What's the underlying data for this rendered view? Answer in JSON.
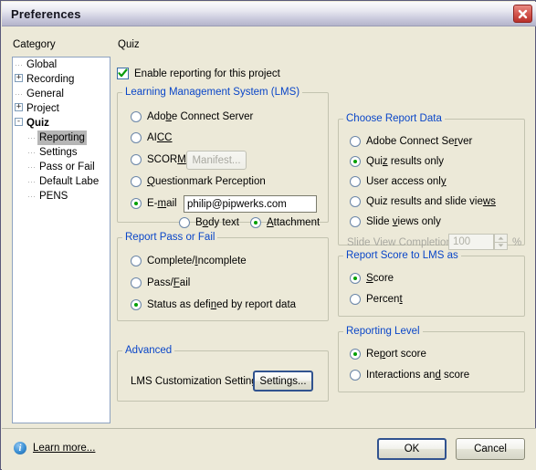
{
  "window": {
    "title": "Preferences",
    "close_icon": "close-icon"
  },
  "sidebar": {
    "header": "Category",
    "items": [
      {
        "label": "Global",
        "level": 1,
        "expander": "",
        "selected": false,
        "bold": false
      },
      {
        "label": "Recording",
        "level": 1,
        "expander": "+",
        "selected": false,
        "bold": false
      },
      {
        "label": "General",
        "level": 1,
        "expander": "",
        "selected": false,
        "bold": false
      },
      {
        "label": "Project",
        "level": 1,
        "expander": "+",
        "selected": false,
        "bold": false
      },
      {
        "label": "Quiz",
        "level": 1,
        "expander": "-",
        "selected": false,
        "bold": true
      },
      {
        "label": "Reporting",
        "level": 2,
        "expander": "",
        "selected": true,
        "bold": false
      },
      {
        "label": "Settings",
        "level": 2,
        "expander": "",
        "selected": false,
        "bold": false
      },
      {
        "label": "Pass or Fail",
        "level": 2,
        "expander": "",
        "selected": false,
        "bold": false
      },
      {
        "label": "Default Labe",
        "level": 2,
        "expander": "",
        "selected": false,
        "bold": false
      },
      {
        "label": "PENS",
        "level": 2,
        "expander": "",
        "selected": false,
        "bold": false
      }
    ]
  },
  "pane": {
    "header": "Quiz",
    "enable_reporting": {
      "label": "Enable reporting for this project",
      "checked": true
    },
    "lms": {
      "legend": "Learning Management System (LMS)",
      "options": [
        {
          "label": "Adobe Connect Server",
          "selected": false
        },
        {
          "label": "AICC",
          "selected": false
        },
        {
          "label": "SCORM",
          "selected": false
        },
        {
          "label": "Questionmark Perception",
          "selected": false
        },
        {
          "label": "E-mail",
          "selected": true
        }
      ],
      "manifest_button": "Manifest...",
      "manifest_disabled": true,
      "email_value": "philip@pipwerks.com",
      "email_format": [
        {
          "label": "Body text",
          "selected": false
        },
        {
          "label": "Attachment",
          "selected": true
        }
      ]
    },
    "report_data": {
      "legend": "Choose Report Data",
      "options": [
        {
          "label": "Adobe Connect Server",
          "selected": false
        },
        {
          "label": "Quiz results only",
          "selected": true
        },
        {
          "label": "User access only",
          "selected": false
        },
        {
          "label": "Quiz results and slide views",
          "selected": false
        },
        {
          "label": "Slide views only",
          "selected": false
        }
      ],
      "slide_view_completion_label": "Slide View Completion:",
      "slide_view_completion_value": "100",
      "slide_view_completion_unit": "%",
      "slide_view_completion_disabled": true
    },
    "pass_fail": {
      "legend": "Report Pass or Fail",
      "options": [
        {
          "label": "Complete/Incomplete",
          "selected": false
        },
        {
          "label": "Pass/Fail",
          "selected": false
        },
        {
          "label": "Status as defined by report data",
          "selected": true
        }
      ]
    },
    "score_as": {
      "legend": "Report Score to LMS as",
      "options": [
        {
          "label": "Score",
          "selected": true
        },
        {
          "label": "Percent",
          "selected": false
        }
      ]
    },
    "reporting_level": {
      "legend": "Reporting Level",
      "options": [
        {
          "label": "Report score",
          "selected": true
        },
        {
          "label": "Interactions and score",
          "selected": false
        }
      ]
    },
    "advanced": {
      "legend": "Advanced",
      "label": "LMS Customization Settings",
      "button": "Settings..."
    }
  },
  "footer": {
    "info_icon": "info-icon",
    "learn_more": "Learn more...",
    "ok": "OK",
    "cancel": "Cancel"
  },
  "colors": {
    "legend_blue": "#0a46c8",
    "radio_green": "#00a000",
    "dialog_bg": "#ece9d8",
    "close_red": "#b8302a"
  }
}
